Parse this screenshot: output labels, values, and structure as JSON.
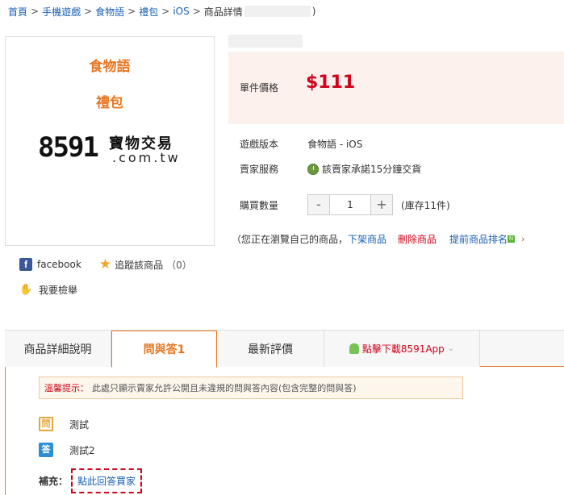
{
  "breadcrumb": {
    "items": [
      "首頁",
      "手機遊戲",
      "食物語",
      "禮包",
      "iOS"
    ],
    "sep": ">",
    "current": "商品詳情",
    "close_paren": ")"
  },
  "product": {
    "image_line1": "食物語",
    "image_line2": "禮包",
    "logo_digits": "8591",
    "logo_text": "寶物交易",
    "logo_domain": ".com.tw",
    "price_label": "單件價格",
    "price": "$111",
    "version_label": "遊戲版本",
    "version_value": "食物語 - iOS",
    "service_label": "賣家服務",
    "service_value": "該賣家承諾15分鐘交貨",
    "quantity_label": "購買數量",
    "quantity_minus": "-",
    "quantity_value": "1",
    "quantity_plus": "+",
    "stock": "(庫存11件)"
  },
  "actions": {
    "note": "（您正在瀏覽自己的商品，",
    "take_down": "下架商品",
    "delete": "刪除商品",
    "promote": "提前商品排名",
    "new_badge": "N",
    "chevron": "›"
  },
  "share": {
    "facebook": "facebook",
    "fb_letter": "f",
    "star": "★",
    "track": "追蹤該商品",
    "track_count": "（0）",
    "hand": "✋",
    "report": "我要檢舉"
  },
  "tabs": [
    {
      "label": "商品詳細說明"
    },
    {
      "label": "問與答1"
    },
    {
      "label": "最新評價"
    },
    {
      "label": "點擊下載8591App",
      "arrow": "⌄"
    }
  ],
  "qa": {
    "tip_label": "溫馨提示：",
    "tip_text": "此處只顯示賣家允許公開且未違規的問與答內容(包含完整的問與答)",
    "question_badge": "問",
    "question": "測試",
    "answer_badge": "答",
    "answer": "測試2",
    "supplement_label": "補充：",
    "reply_link": "點此回答買家"
  },
  "colors": {
    "accent": "#e87722",
    "price": "#d0021b",
    "link": "#1a5fb4"
  }
}
